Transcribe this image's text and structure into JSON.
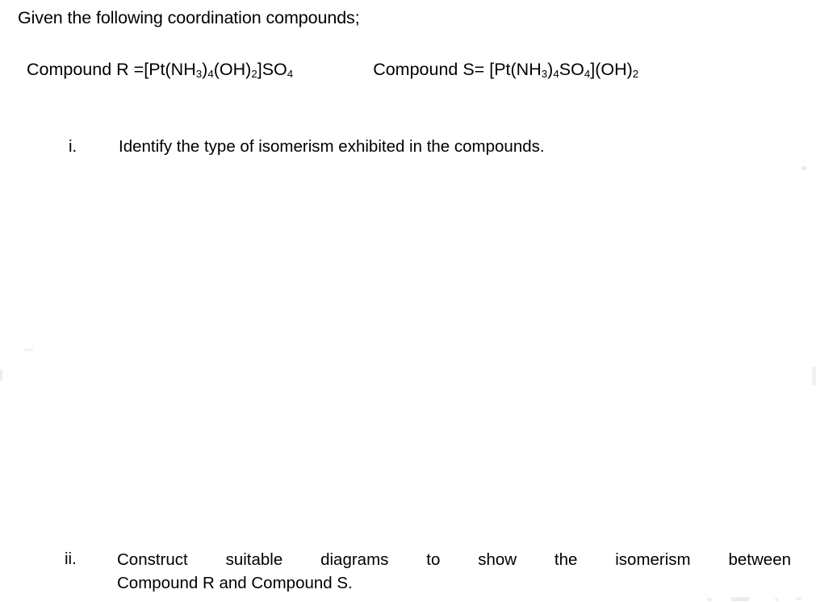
{
  "document": {
    "background_color": "#ffffff",
    "text_color": "#000000",
    "intro_line": "Given the following coordination compounds;",
    "compounds": {
      "r": {
        "label": "Compound R =",
        "formula_plain": "[Pt(NH3)4(OH)2]SO4",
        "formula_parts": [
          {
            "text": "[Pt(NH",
            "sub": false
          },
          {
            "text": "3",
            "sub": true
          },
          {
            "text": ")",
            "sub": false
          },
          {
            "text": "4",
            "sub": true
          },
          {
            "text": "(OH)",
            "sub": false
          },
          {
            "text": "2",
            "sub": true
          },
          {
            "text": "]SO",
            "sub": false
          },
          {
            "text": "4",
            "sub": true
          }
        ]
      },
      "s": {
        "label": "Compound S= ",
        "formula_plain": "[Pt(NH3)4SO4](OH)2",
        "formula_parts": [
          {
            "text": "[Pt(NH",
            "sub": false
          },
          {
            "text": "3",
            "sub": true
          },
          {
            "text": ")",
            "sub": false
          },
          {
            "text": "4",
            "sub": true
          },
          {
            "text": "SO",
            "sub": false
          },
          {
            "text": "4",
            "sub": true
          },
          {
            "text": "](OH)",
            "sub": false
          },
          {
            "text": "2",
            "sub": true
          }
        ]
      }
    },
    "questions": [
      {
        "marker": "i.",
        "text": "Identify the type of isomerism exhibited in the compounds."
      },
      {
        "marker": "ii.",
        "line1": "Construct suitable diagrams to show the isomerism between",
        "line2": "Compound R and Compound S."
      }
    ]
  }
}
